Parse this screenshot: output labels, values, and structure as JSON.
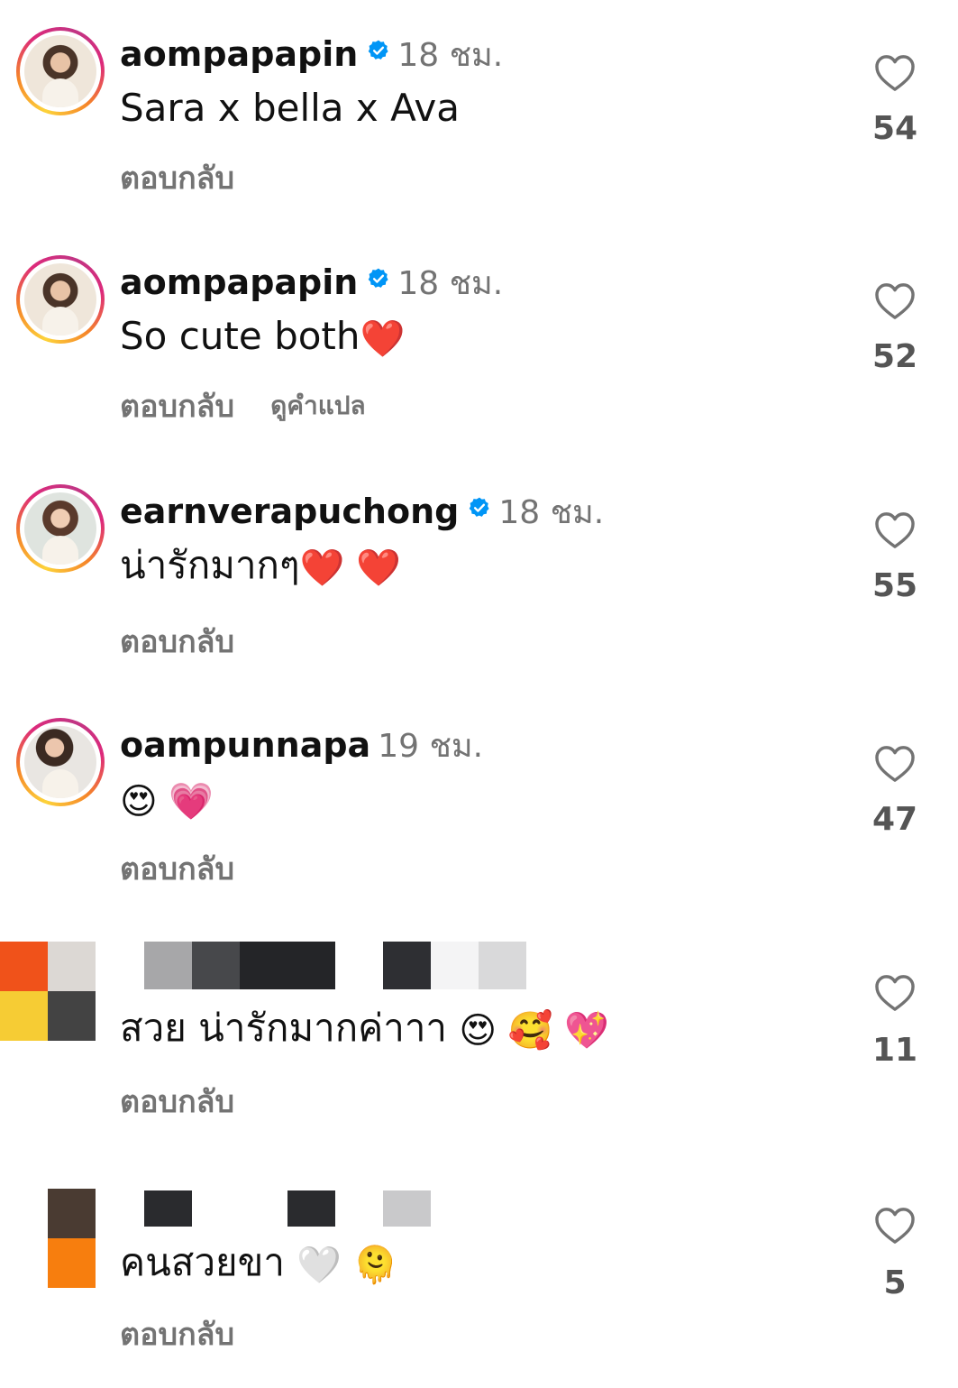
{
  "comments": [
    {
      "username": "aompapapin",
      "verified": true,
      "time": "18 ชม.",
      "text": "Sara x bella x Ava",
      "emojis": "",
      "reply_label": "ตอบกลับ",
      "translate_label": "",
      "likes": "54"
    },
    {
      "username": "aompapapin",
      "verified": true,
      "time": "18 ชม.",
      "text": "So cute both",
      "emojis": "❤️",
      "reply_label": "ตอบกลับ",
      "translate_label": "ดูคำแปล",
      "likes": "52"
    },
    {
      "username": "earnverapuchong",
      "verified": true,
      "time": "18 ชม.",
      "text": "น่ารักมากๆ",
      "emojis": "❤️ ❤️",
      "reply_label": "ตอบกลับ",
      "translate_label": "",
      "likes": "55"
    },
    {
      "username": "oampunnapa",
      "verified": false,
      "time": "19 ชม.",
      "text": "",
      "emojis": "😍 💗",
      "reply_label": "ตอบกลับ",
      "translate_label": "",
      "likes": "47"
    },
    {
      "username": "",
      "verified": false,
      "time": "",
      "text": "สวย น่ารักมากค่าาา",
      "emojis": "😍 🥰 💖",
      "reply_label": "ตอบกลับ",
      "translate_label": "",
      "likes": "11"
    },
    {
      "username": "",
      "verified": false,
      "time": "",
      "text": "คนสวยขา",
      "emojis": "🤍 🫠",
      "reply_label": "ตอบกลับ",
      "translate_label": "",
      "likes": "5"
    }
  ],
  "icons": {
    "like": "heart-outline-icon",
    "verified": "verified-badge-icon"
  },
  "colors": {
    "verified_blue": "#0095f6",
    "secondary_text": "#737373"
  }
}
